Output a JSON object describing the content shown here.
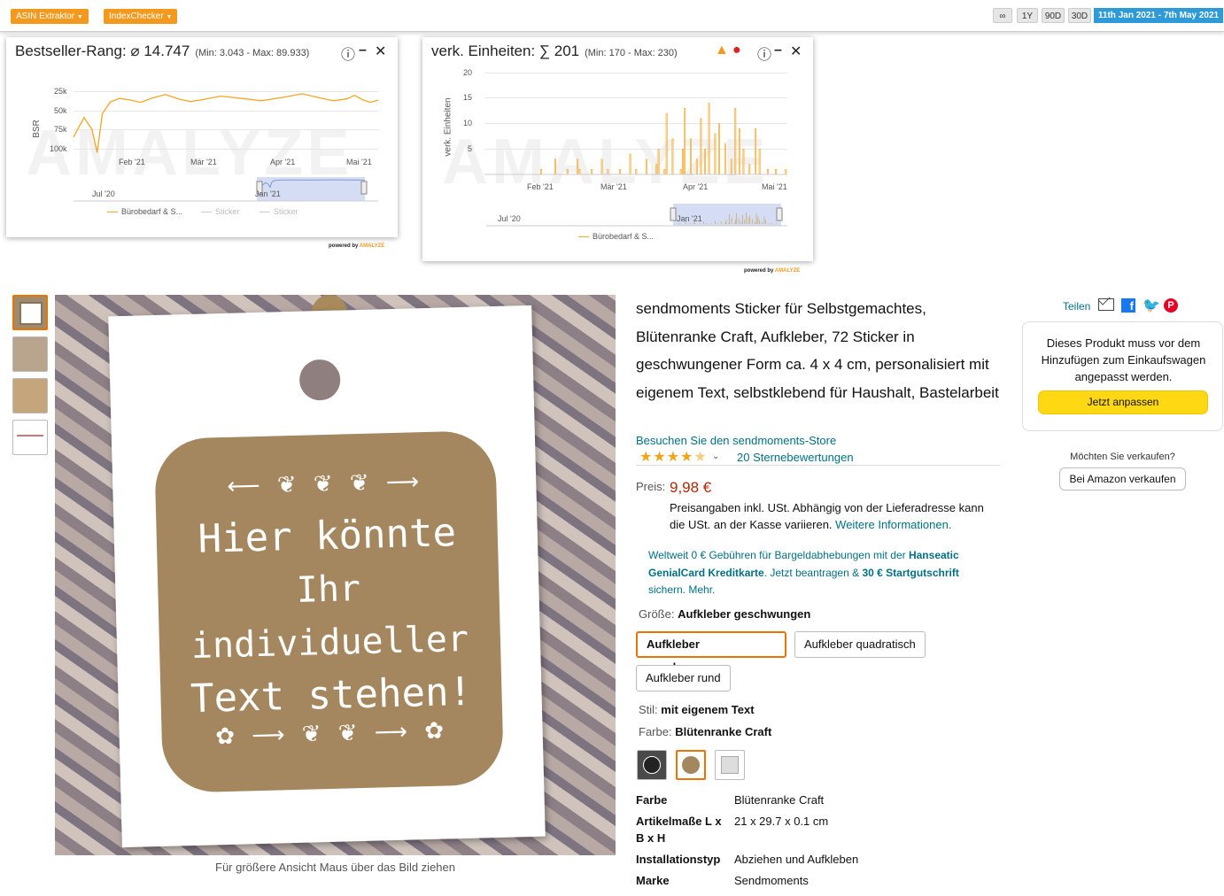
{
  "toolbar": {
    "asin_extractor": "ASIN Extraktor",
    "index_checker": "IndexChecker",
    "range_all": "∞",
    "range_1y": "1Y",
    "range_90d": "90D",
    "range_30d": "30D",
    "date_range": "11th Jan 2021 - 7th May 2021"
  },
  "bsr_panel": {
    "title": "Bestseller-Rang: ⌀ 14.747",
    "minmax": "(Min: 3.043 - Max: 89.933)",
    "ylabel": "BSR",
    "watermark": "AMALYZE",
    "y_ticks": [
      "25k",
      "50k",
      "75k",
      "100k"
    ],
    "x_ticks": [
      "Feb '21",
      "Mär '21",
      "Apr '21",
      "Mai '21"
    ],
    "nav_ticks": [
      "Jul '20",
      "Jan '21"
    ],
    "legend": [
      "Bürobedarf & S...",
      "Sticker",
      "Sticker"
    ],
    "powered": "powered by",
    "powered_brand": "AMALYZE"
  },
  "units_panel": {
    "title": "verk. Einheiten: ∑ 201",
    "minmax": "(Min: 170 - Max: 230)",
    "ylabel": "verk. Einheiten",
    "watermark": "AMALYZE",
    "y_ticks": [
      "20",
      "15",
      "10",
      "5"
    ],
    "x_ticks": [
      "Feb '21",
      "Mär '21",
      "Apr '21",
      "Mai '21"
    ],
    "nav_ticks": [
      "Jul '20",
      "Jan '21"
    ],
    "legend": [
      "Bürobedarf & S..."
    ],
    "powered": "powered by",
    "powered_brand": "AMALYZE"
  },
  "chart_data": [
    {
      "type": "line",
      "title": "Bestseller-Rang: ⌀ 14.747",
      "ylabel": "BSR",
      "y_inverted": true,
      "ylim": [
        0,
        100000
      ],
      "x": [
        "2021-01-11",
        "2021-01-15",
        "2021-01-18",
        "2021-01-20",
        "2021-01-22",
        "2021-01-25",
        "2021-02-01",
        "2021-02-10",
        "2021-02-20",
        "2021-03-01",
        "2021-03-15",
        "2021-04-01",
        "2021-04-15",
        "2021-04-25",
        "2021-05-01",
        "2021-05-07"
      ],
      "series": [
        {
          "name": "Bürobedarf & S...",
          "values": [
            60000,
            35000,
            50000,
            80000,
            30000,
            15000,
            12000,
            10000,
            11000,
            12000,
            10000,
            9000,
            10000,
            11000,
            12000,
            12500
          ]
        }
      ]
    },
    {
      "type": "bar",
      "title": "verk. Einheiten: ∑ 201",
      "ylabel": "verk. Einheiten",
      "ylim": [
        0,
        20
      ],
      "x_range": [
        "2021-01-11",
        "2021-05-07"
      ],
      "series": [
        {
          "name": "Bürobedarf & S...",
          "values": [
            0,
            0,
            0,
            0,
            0,
            1,
            0,
            0,
            0,
            0,
            0,
            0,
            3,
            0,
            0,
            0,
            0,
            0,
            1,
            0,
            0,
            0,
            0,
            3,
            1,
            0,
            0,
            0,
            0,
            0,
            1,
            0,
            0,
            0,
            0,
            3,
            0,
            0,
            1,
            0,
            0,
            0,
            0,
            0,
            1,
            0,
            0,
            0,
            0,
            4,
            0,
            0,
            1,
            0,
            0,
            0,
            0,
            3,
            0,
            0,
            0,
            0,
            2,
            5,
            0,
            0,
            1,
            12,
            0,
            0,
            7,
            0,
            0,
            0,
            1,
            5,
            13,
            0,
            0,
            7,
            0,
            0,
            3,
            0,
            11,
            0,
            5,
            0,
            14,
            0,
            0,
            8,
            0,
            10,
            0,
            0,
            6,
            0,
            0,
            3,
            0,
            13,
            0,
            9,
            0,
            5,
            0,
            0,
            2,
            0,
            0,
            9,
            0,
            5,
            0,
            0,
            0,
            1,
            0,
            0,
            0,
            1,
            0,
            0,
            0,
            0,
            1
          ]
        }
      ]
    }
  ],
  "product": {
    "thumbnails": [
      "thumb-1",
      "thumb-2",
      "thumb-3",
      "thumb-4"
    ],
    "tag_text_1": "Hier könnte",
    "tag_text_2": "Ihr individueller",
    "tag_text_3": "Text stehen!",
    "zoom_hint": "Für größere Ansicht Maus über das Bild ziehen",
    "title": "sendmoments Sticker für Selbstgemachtes, Blütenranke Craft, Aufkleber, 72 Sticker in geschwungener Form ca. 4 x 4 cm, personalisiert mit eigenem Text, selbstklebend für Haushalt, Bastelarbeit",
    "store_link": "Besuchen Sie den sendmoments-Store",
    "rating_count": "20 Sternebewertungen",
    "rating": 4.5,
    "price_label": "Preis:",
    "price": "9,98 €",
    "price_note": "Preisangaben inkl. USt. Abhängig von der Lieferadresse kann die USt. an der Kasse variieren.",
    "more_info": "Weitere Informationen.",
    "promo_1": "Weltweit 0 € Gebühren für Bargeldabhebungen mit der",
    "promo_bold_1": "Hanseatic GenialCard Kreditkarte",
    "promo_2": ". Jetzt beantragen &",
    "promo_bold_2": "30 € Startgutschrift",
    "promo_3": "sichern. Mehr.",
    "size_label": "Größe:",
    "size_value": "Aufkleber geschwungen",
    "size_options": [
      "Aufkleber geschwungen",
      "Aufkleber quadratisch",
      "Aufkleber rund"
    ],
    "style_label": "Stil:",
    "style_value": "mit eigenem Text",
    "color_label": "Farbe:",
    "color_value": "Blütenranke Craft",
    "specs": [
      {
        "label": "Farbe",
        "value": "Blütenranke Craft"
      },
      {
        "label": "Artikelmaße L x B x H",
        "value": "21 x 29.7 x 0.1 cm"
      },
      {
        "label": "Installationstyp",
        "value": "Abziehen und Aufkleben"
      },
      {
        "label": "Marke",
        "value": "Sendmoments"
      }
    ]
  },
  "share": {
    "label": "Teilen"
  },
  "buybox": {
    "message": "Dieses Produkt muss vor dem Hinzufügen zum Einkaufswagen angepasst werden.",
    "button": "Jetzt anpassen",
    "sell_question": "Möchten Sie verkaufen?",
    "sell_button": "Bei Amazon verkaufen"
  },
  "colors": {
    "accent_orange": "#f39a1e",
    "amazon_yellow": "#ffd814",
    "price_red": "#b12704",
    "link": "#007185",
    "date_blue": "#2e9ad7"
  }
}
